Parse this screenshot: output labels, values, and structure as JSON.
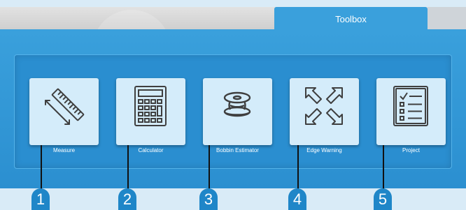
{
  "header": {
    "tab_label": "Toolbox"
  },
  "toolbox": {
    "tools": [
      {
        "label": "Measure",
        "icon": "ruler-icon"
      },
      {
        "label": "Calculator",
        "icon": "calculator-icon"
      },
      {
        "label": "Bobbin Estimator",
        "icon": "bobbin-icon"
      },
      {
        "label": "Edge Warning",
        "icon": "expand-arrows-icon"
      },
      {
        "label": "Project",
        "icon": "checklist-icon"
      }
    ]
  },
  "callouts": [
    "1",
    "2",
    "3",
    "4",
    "5"
  ],
  "colors": {
    "panel": "#3aa0dc",
    "inner_panel": "#2a8ed0",
    "tile": "#d4ecfa",
    "icon_stroke": "#3f3f3f",
    "badge": "#1f86c8"
  }
}
